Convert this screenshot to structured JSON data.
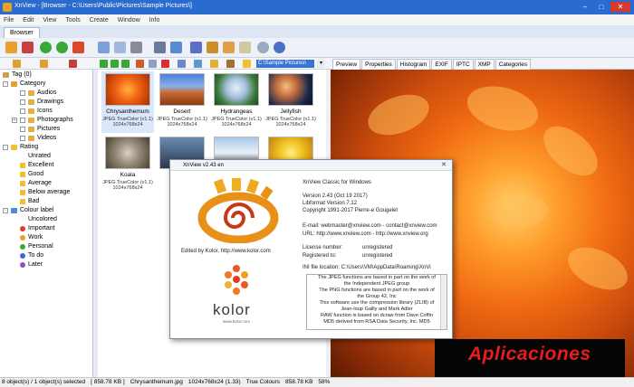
{
  "window": {
    "title": "XnView - [Browser - C:\\Users\\Public\\Pictures\\Sample Pictures\\]"
  },
  "menu": [
    "File",
    "Edit",
    "View",
    "Tools",
    "Create",
    "Window",
    "Info"
  ],
  "tabs": {
    "browser": "Browser"
  },
  "address": "C:\\Sample Pictures\\",
  "tree": {
    "tag": "Tag (0)",
    "category": "Category",
    "category_items": [
      "Audios",
      "Drawings",
      "Icons",
      "Photographs",
      "Pictures",
      "Videos"
    ],
    "rating": "Rating",
    "rating_items": [
      "Unrated",
      "Excellent",
      "Good",
      "Average",
      "Below average",
      "Bad"
    ],
    "colour_label": "Colour label",
    "colour_items": [
      {
        "label": "Uncolored",
        "color": "#ffffff"
      },
      {
        "label": "Important",
        "color": "#e03a2a"
      },
      {
        "label": "Work",
        "color": "#f0a020"
      },
      {
        "label": "Personal",
        "color": "#38a838"
      },
      {
        "label": "To do",
        "color": "#3a6ad8"
      },
      {
        "label": "Later",
        "color": "#9a4ac8"
      }
    ]
  },
  "thumbnails": [
    {
      "name": "Chrysanthemum",
      "format": "JPEG TrueColor (v1.1)",
      "dims": "1024x768x24"
    },
    {
      "name": "Desert",
      "format": "JPEG TrueColor (v1.1)",
      "dims": "1024x768x24"
    },
    {
      "name": "Hydrangeas",
      "format": "JPEG TrueColor (v1.1)",
      "dims": "1024x768x24"
    },
    {
      "name": "Jellyfish",
      "format": "JPEG TrueColor (v1.1)",
      "dims": "1024x768x24"
    },
    {
      "name": "Koala",
      "format": "JPEG TrueColor (v1.1)",
      "dims": "1024x768x24"
    },
    {
      "name": "",
      "format": "",
      "dims": ""
    },
    {
      "name": "",
      "format": "",
      "dims": ""
    },
    {
      "name": "",
      "format": "",
      "dims": ""
    }
  ],
  "preview_tabs": [
    "Preview",
    "Properties",
    "Histogram",
    "EXIF",
    "IPTC",
    "XMP",
    "Categories"
  ],
  "about": {
    "title": "XnView v2.43 en",
    "product": "XnView Classic for Windows",
    "version": "Version 2.43 (Oct 19 2017)",
    "libformat": "Libformat Version 7.12",
    "copyright": "Copyright 1991-2017 Pierre-e Gougelet",
    "email": "E-mail: webmaster@xnview.com - contact@xnview.com",
    "url": "URL: http://www.xnview.com - http://www.xnview.org",
    "license_label": "License number:",
    "license_value": "unregistered",
    "registered_label": "Registered to:",
    "registered_value": "unregistered",
    "ini": "INI file location: C:\\Users\\VM\\AppData\\Roaming\\XnVi",
    "edited_by": "Edited by Kolor, http://www.kolor.com",
    "kolor_logo": "kolor",
    "kolor_url": "www.kolor.com",
    "license_lines": [
      "The JPEG functions are based in part on the work of",
      "the Independent JPEG group",
      "The PNG functions are based in part on the work of",
      "the Group 42, Inc",
      "This software use the compression library (ZLIB) of",
      "Jean-loup Gailly and Mark Adler",
      "RAW function is based on dcraw from Dave Coffin",
      "MD5 derived from RSA Data Security, Inc. MD5"
    ]
  },
  "status": {
    "selection": "8 object(s) / 1 object(s) selected",
    "size": "[ 858.78 KB ]",
    "file": "Chrysanthemum.jpg",
    "dims": "1024x768x24 (1.33)",
    "colours": "True Colours",
    "filesize": "858.78 KB",
    "zoom": "58%"
  },
  "watermark": "Aplicaciones"
}
